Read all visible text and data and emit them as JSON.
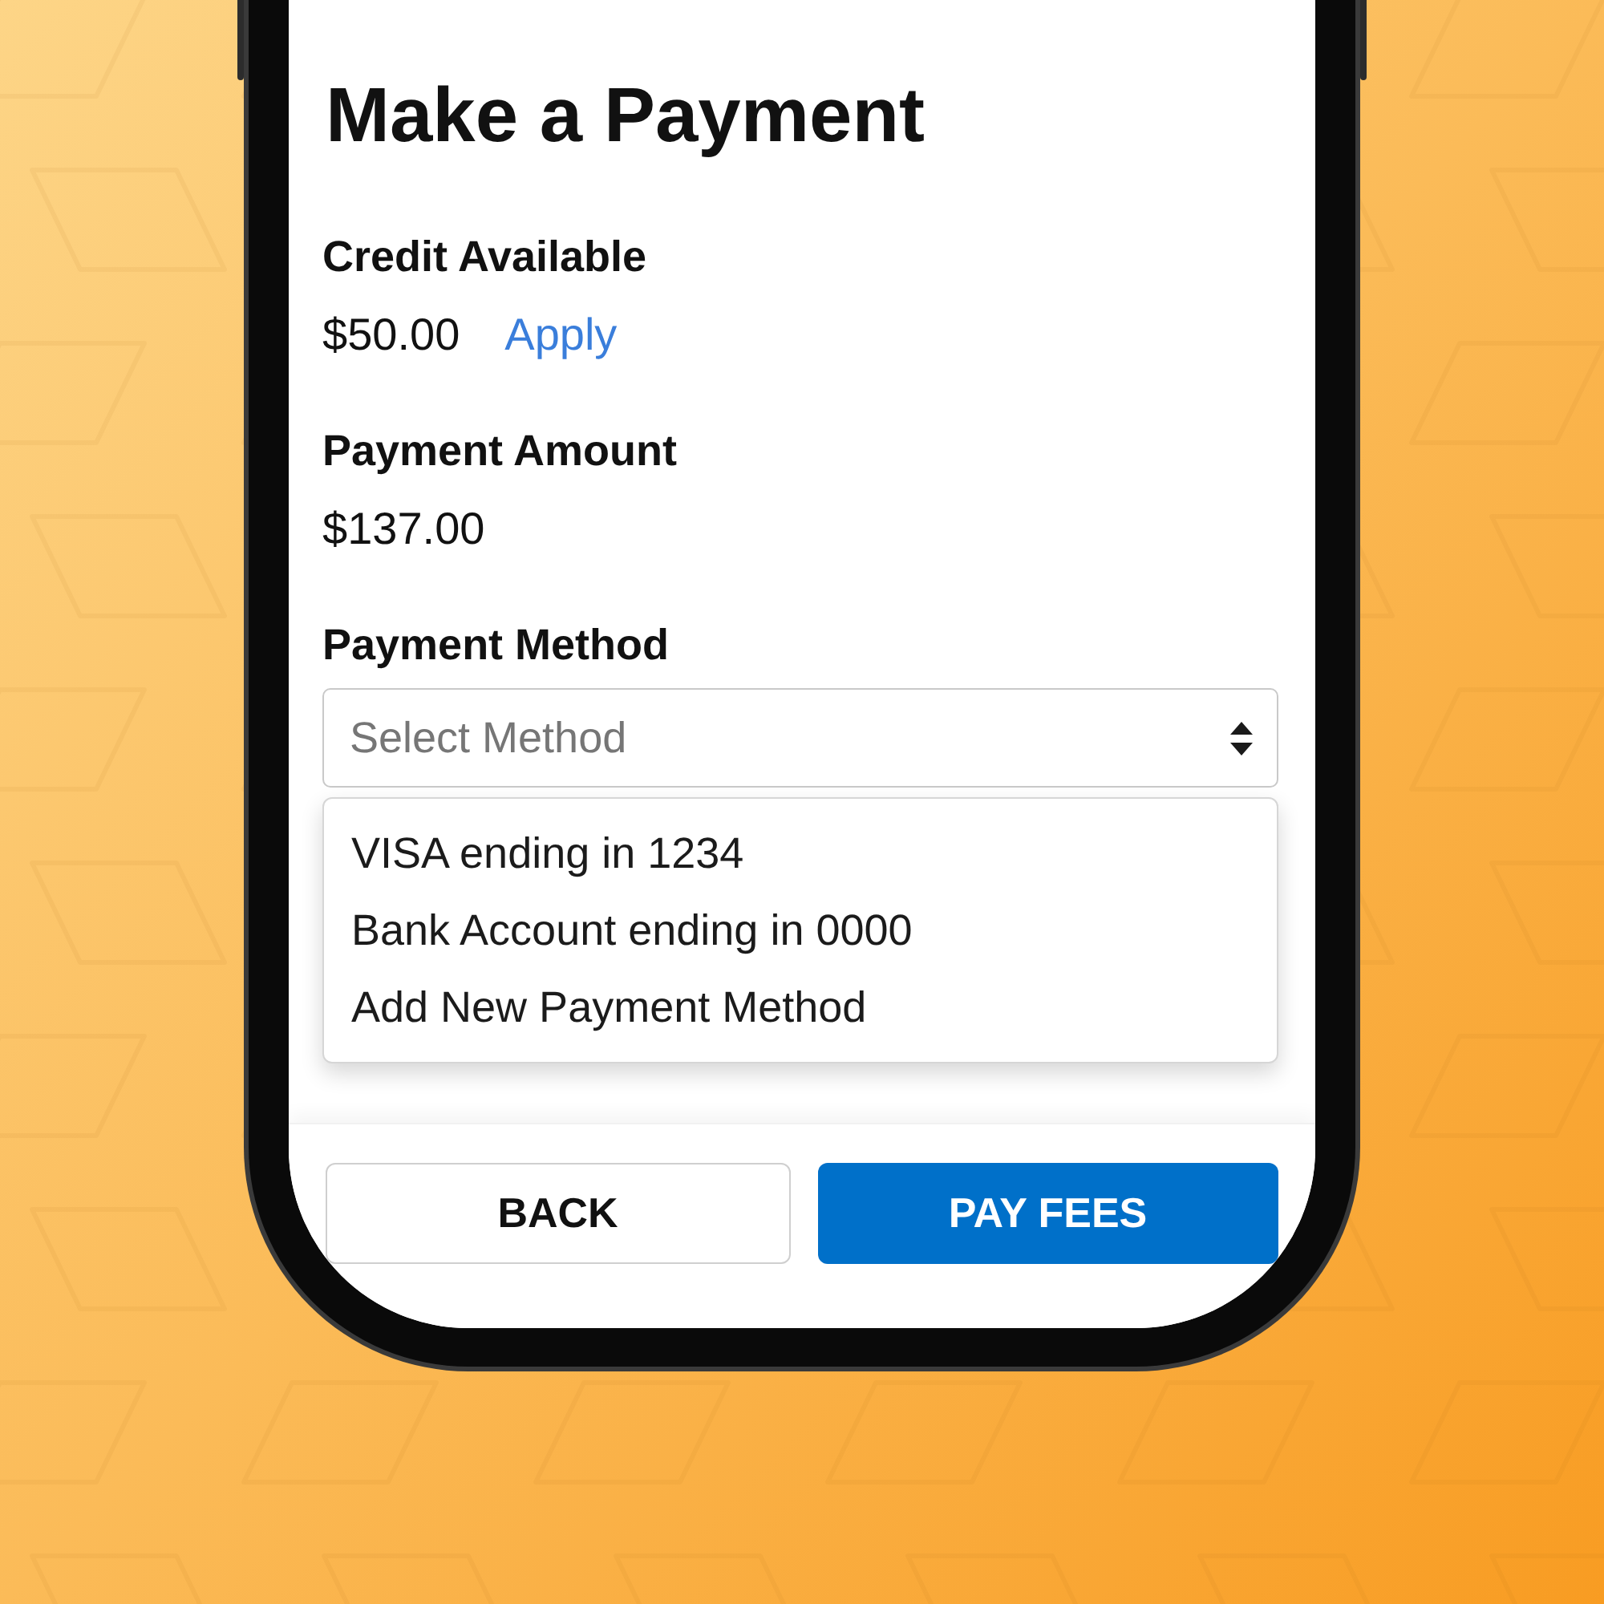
{
  "screen": {
    "title": "Make a Payment"
  },
  "sections": [
    {
      "label": "Credit Available",
      "value": "$50.00",
      "action": "Apply"
    },
    {
      "label": "Payment Amount",
      "value": "$137.00"
    }
  ],
  "payment_method": {
    "label": "Payment Method",
    "placeholder": "Select Method",
    "expanded": true,
    "options": [
      {
        "label": "VISA ending in 1234",
        "selected": false
      },
      {
        "label": "Bank Account ending in 0000",
        "selected": false
      },
      {
        "label": "Add New Payment Method",
        "selected": false
      }
    ]
  },
  "buttons": [
    {
      "label": "BACK",
      "kind": "secondary"
    },
    {
      "label": "PAY FEES",
      "kind": "primary"
    }
  ]
}
